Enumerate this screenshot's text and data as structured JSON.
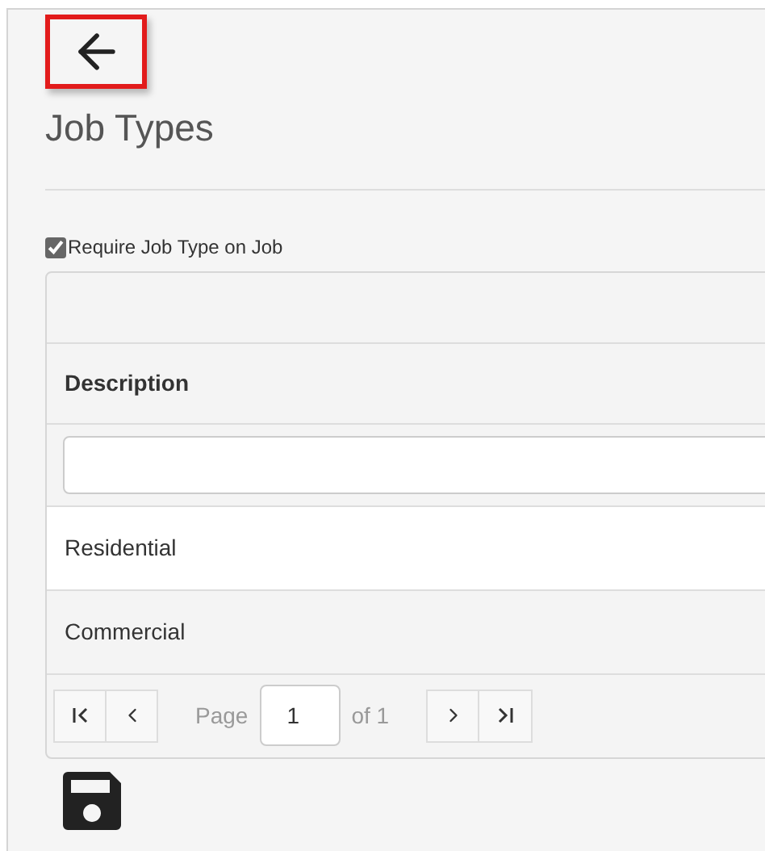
{
  "title": "Job Types",
  "require_checkbox": {
    "label": "Require Job Type on Job",
    "checked": true
  },
  "grid": {
    "columns": [
      {
        "header": "Description"
      }
    ],
    "rows": [
      {
        "description": "Residential"
      },
      {
        "description": "Commercial"
      }
    ],
    "pager": {
      "page_label": "Page",
      "page_value": "1",
      "of_label": "of 1"
    }
  }
}
